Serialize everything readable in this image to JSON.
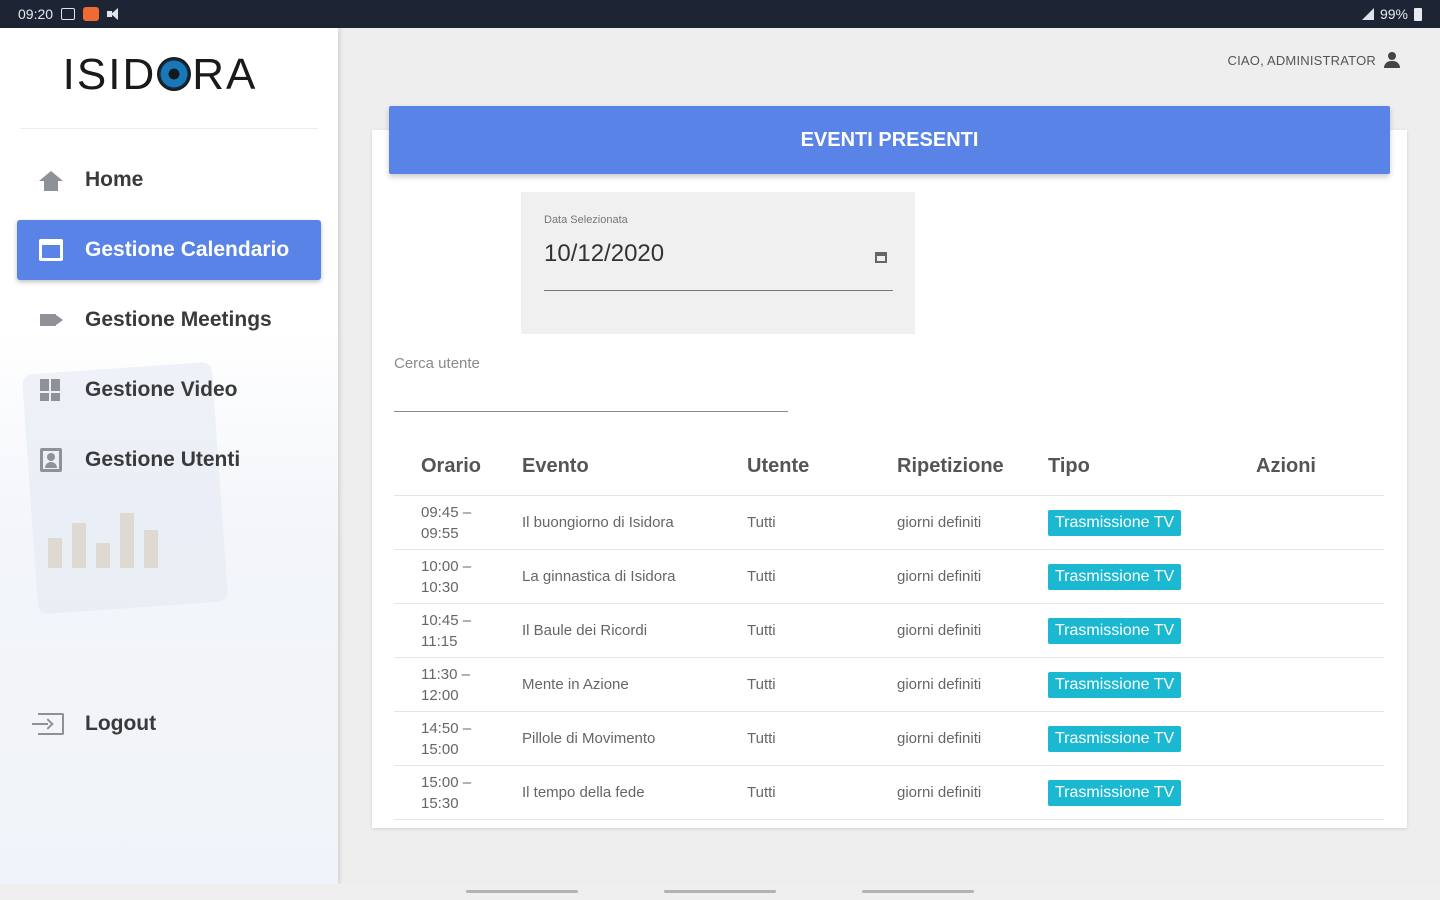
{
  "statusbar": {
    "time": "09:20",
    "battery": "99%"
  },
  "brand": {
    "logo_left": "ISID",
    "logo_right": "RA"
  },
  "sidebar": {
    "items": [
      {
        "label": "Home",
        "icon": "home-icon"
      },
      {
        "label": "Gestione Calendario",
        "icon": "calendar-icon",
        "active": true
      },
      {
        "label": "Gestione Meetings",
        "icon": "videocam-icon"
      },
      {
        "label": "Gestione Video",
        "icon": "dashboard-icon"
      },
      {
        "label": "Gestione Utenti",
        "icon": "user-badge-icon"
      }
    ],
    "logout_label": "Logout"
  },
  "header": {
    "greeting": "CIAO, ADMINISTRATOR"
  },
  "card": {
    "title": "EVENTI PRESENTI"
  },
  "date": {
    "label": "Data Selezionata",
    "value": "10/12/2020"
  },
  "search": {
    "label": "Cerca utente",
    "value": ""
  },
  "table": {
    "columns": [
      "Orario",
      "Evento",
      "Utente",
      "Ripetizione",
      "Tipo",
      "Azioni"
    ],
    "rows": [
      {
        "start": "09:45 –",
        "end": "09:55",
        "event": "Il buongiorno di Isidora",
        "user": "Tutti",
        "repeat": "giorni definiti",
        "type": "Trasmissione TV"
      },
      {
        "start": "10:00 –",
        "end": "10:30",
        "event": "La ginnastica di Isidora",
        "user": "Tutti",
        "repeat": "giorni definiti",
        "type": "Trasmissione TV"
      },
      {
        "start": "10:45 –",
        "end": "11:15",
        "event": "Il Baule dei Ricordi",
        "user": "Tutti",
        "repeat": "giorni definiti",
        "type": "Trasmissione TV"
      },
      {
        "start": "11:30 –",
        "end": "12:00",
        "event": "Mente in Azione",
        "user": "Tutti",
        "repeat": "giorni definiti",
        "type": "Trasmissione TV"
      },
      {
        "start": "14:50 –",
        "end": "15:00",
        "event": "Pillole di Movimento",
        "user": "Tutti",
        "repeat": "giorni definiti",
        "type": "Trasmissione TV"
      },
      {
        "start": "15:00 –",
        "end": "15:30",
        "event": "Il tempo della fede",
        "user": "Tutti",
        "repeat": "giorni definiti",
        "type": "Trasmissione TV"
      }
    ]
  },
  "colors": {
    "primary": "#5983e6",
    "badge": "#1bb8d2",
    "statusbar": "#1d2535"
  }
}
